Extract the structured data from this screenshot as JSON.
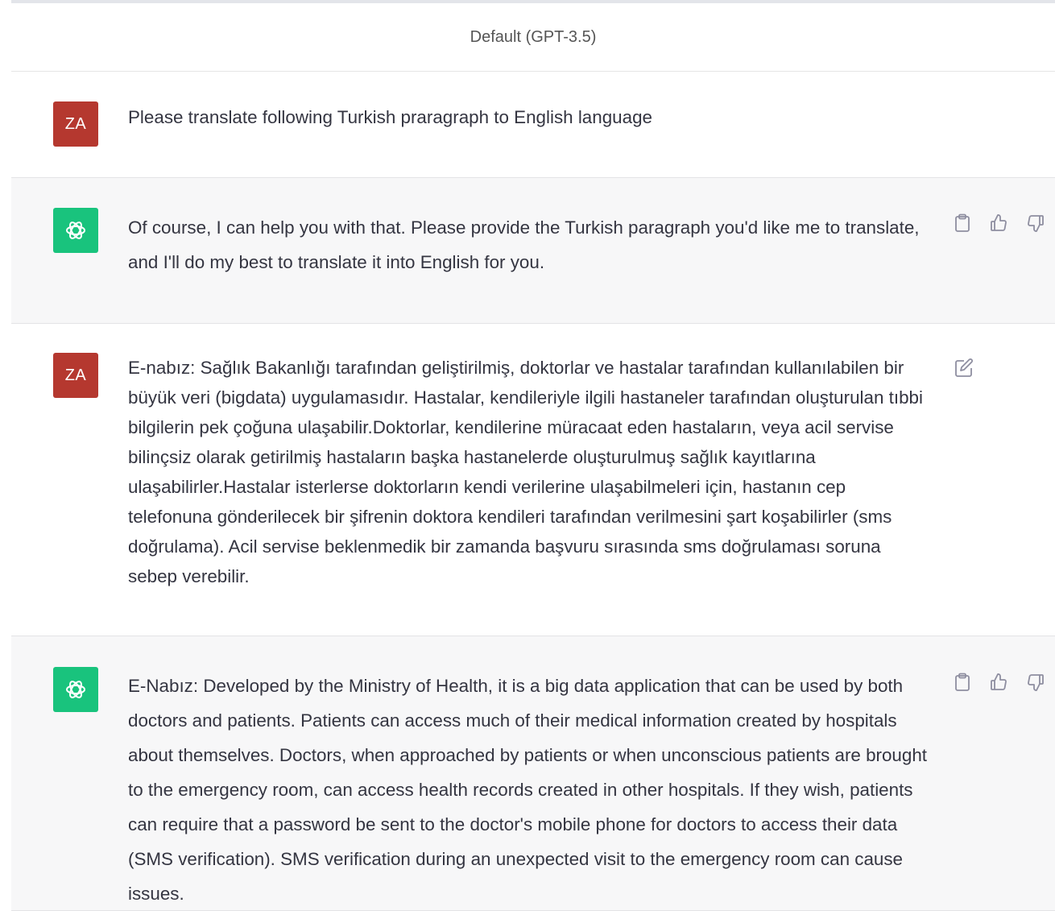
{
  "header": {
    "model_label": "Default (GPT-3.5)"
  },
  "messages": [
    {
      "role": "user",
      "avatar_initials": "ZA",
      "text": "Please translate following Turkish praragraph to English language"
    },
    {
      "role": "assistant",
      "text": "Of course, I can help you with that. Please provide the Turkish paragraph you'd like me to translate, and I'll do my best to translate it into English for you."
    },
    {
      "role": "user",
      "avatar_initials": "ZA",
      "text": "E-nabız: Sağlık Bakanlığı tarafından geliştirilmiş, doktorlar ve hastalar tarafından kullanılabilen bir büyük veri (bigdata) uygulamasıdır. Hastalar, kendileriyle ilgili hastaneler tarafından oluşturulan tıbbi bilgilerin pek çoğuna ulaşabilir.Doktorlar, kendilerine müracaat eden hastaların, veya acil servise bilinçsiz olarak getirilmiş hastaların başka hastanelerde oluşturulmuş sağlık kayıtlarına ulaşabilirler.Hastalar isterlerse doktorların kendi verilerine ulaşabilmeleri için, hastanın cep telefonuna gönderilecek bir şifrenin doktora kendileri tarafından verilmesini şart koşabilirler (sms doğrulama). Acil servise beklenmedik bir zamanda başvuru sırasında sms doğrulaması soruna sebep verebilir."
    },
    {
      "role": "assistant",
      "text": "E-Nabız: Developed by the Ministry of Health, it is a big data application that can be used by both doctors and patients. Patients can access much of their medical information created by hospitals about themselves. Doctors, when approached by patients or when unconscious patients are brought to the emergency room, can access health records created in other hospitals. If they wish, patients can require that a password be sent to the doctor's mobile phone for doctors to access their data (SMS verification). SMS verification during an unexpected visit to the emergency room can cause issues."
    }
  ],
  "icons": {
    "copy": "clipboard-icon",
    "like": "thumbs-up-icon",
    "dislike": "thumbs-down-icon",
    "edit": "edit-icon",
    "bot_logo": "openai-logo-icon"
  },
  "colors": {
    "user_avatar": "#b5382f",
    "bot_avatar": "#19c37d",
    "assistant_bg": "#f7f7f8",
    "icon_gray": "#8e8ea0"
  }
}
